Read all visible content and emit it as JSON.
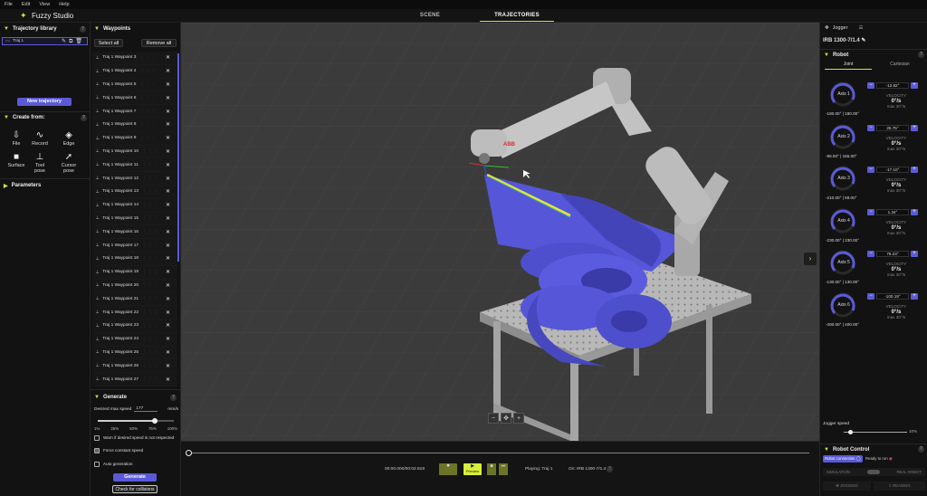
{
  "menu": [
    "File",
    "Edit",
    "View",
    "Help"
  ],
  "app": {
    "name": "Fuzzy Studio"
  },
  "tabs": {
    "scene": "SCENE",
    "trajectories": "TRAJECTORIES"
  },
  "traj_library": {
    "title": "Trajectory library",
    "item": "Traj 1",
    "new_btn": "New trajectory"
  },
  "create_from": {
    "title": "Create from:",
    "tools": [
      "File",
      "Record",
      "Edge",
      "Surface",
      "Tool pose",
      "Cursor pose"
    ]
  },
  "parameters": {
    "title": "Parameters"
  },
  "waypoints": {
    "title": "Waypoints",
    "select_all": "Select all",
    "remove_all": "Remove all",
    "items": [
      "Traj 1 Waypoint 3",
      "Traj 1 Waypoint 4",
      "Traj 1 Waypoint 5",
      "Traj 1 Waypoint 6",
      "Traj 1 Waypoint 7",
      "Traj 1 Waypoint 8",
      "Traj 1 Waypoint 9",
      "Traj 1 Waypoint 10",
      "Traj 1 Waypoint 11",
      "Traj 1 Waypoint 12",
      "Traj 1 Waypoint 13",
      "Traj 1 Waypoint 14",
      "Traj 1 Waypoint 15",
      "Traj 1 Waypoint 16",
      "Traj 1 Waypoint 17",
      "Traj 1 Waypoint 18",
      "Traj 1 Waypoint 19",
      "Traj 1 Waypoint 20",
      "Traj 1 Waypoint 21",
      "Traj 1 Waypoint 22",
      "Traj 1 Waypoint 23",
      "Traj 1 Waypoint 24",
      "Traj 1 Waypoint 25",
      "Traj 1 Waypoint 26",
      "Traj 1 Waypoint 27"
    ]
  },
  "generate": {
    "title": "Generate",
    "speed_label": "Desired max speed",
    "speed_value": "177",
    "speed_unit": "mm/s",
    "ticks": [
      "1%",
      "25%",
      "50%",
      "75%",
      "100%"
    ],
    "slider_level": 0.75,
    "opt_warn": "Warn if desired speed is not respected",
    "opt_force": "Force constant speed",
    "opt_auto": "Auto generation",
    "generate_btn": "Generate",
    "check_btn": "Check for collisions"
  },
  "timeline": {
    "time": "00:00.000/00:02.819",
    "preview": "Preview",
    "playing": "Playing:",
    "playing_val": "Traj 1",
    "on": "On:",
    "on_val": "IRB 1300-7/1.4"
  },
  "jogger": {
    "title": "Jogger",
    "model": "IRB 1300-7/1.4",
    "robot_title": "Robot",
    "tab_joint": "Joint",
    "tab_cart": "Cartesian",
    "axes": [
      {
        "name": "Axis 1",
        "value": "-12.82°",
        "min": "-180.00°",
        "max": "180.00°"
      },
      {
        "name": "Axis 2",
        "value": "25.75°",
        "min": "-95.00°",
        "max": "155.00°"
      },
      {
        "name": "Axis 3",
        "value": "-17.10°",
        "min": "-210.00°",
        "max": "69.00°"
      },
      {
        "name": "Axis 4",
        "value": "1.34°",
        "min": "-230.00°",
        "max": "230.00°"
      },
      {
        "name": "Axis 5",
        "value": "76.23°",
        "min": "-130.00°",
        "max": "130.00°"
      },
      {
        "name": "Axis 6",
        "value": "-100.19°",
        "min": "-400.00°",
        "max": "400.00°"
      }
    ],
    "velocity_label": "VELOCITY",
    "velocity_value": "0°/s",
    "velocity_max": "max 30°/s",
    "speed_label": "Jogger speed",
    "speed_pct": "10%",
    "speed_level": 0.1
  },
  "robot_control": {
    "title": "Robot Control",
    "connection": "Robot connection",
    "ready": "Ready to run",
    "simulation": "SIMULATION",
    "real": "REAL ROBOT",
    "jogging": "JOGGING",
    "reading": "READING"
  },
  "colors": {
    "accent": "#c8e64a",
    "purple": "#5a5ad8",
    "bg": "#121212"
  }
}
